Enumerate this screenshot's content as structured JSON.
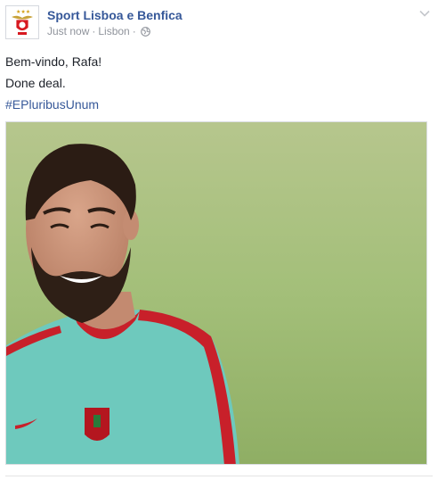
{
  "post": {
    "page_name": "Sport Lisboa e Benfica",
    "timestamp": "Just now",
    "location": "Lisbon",
    "separator": "·",
    "body_lines": [
      "Bem-vindo, Rafa!",
      "Done deal."
    ],
    "hashtag": "#EPluribusUnum",
    "icons": {
      "avatar": "benfica-crest-logo",
      "privacy": "globe-icon",
      "menu": "chevron-down-icon"
    },
    "colors": {
      "link": "#365899",
      "meta": "#90949c",
      "text": "#1d2129"
    }
  }
}
